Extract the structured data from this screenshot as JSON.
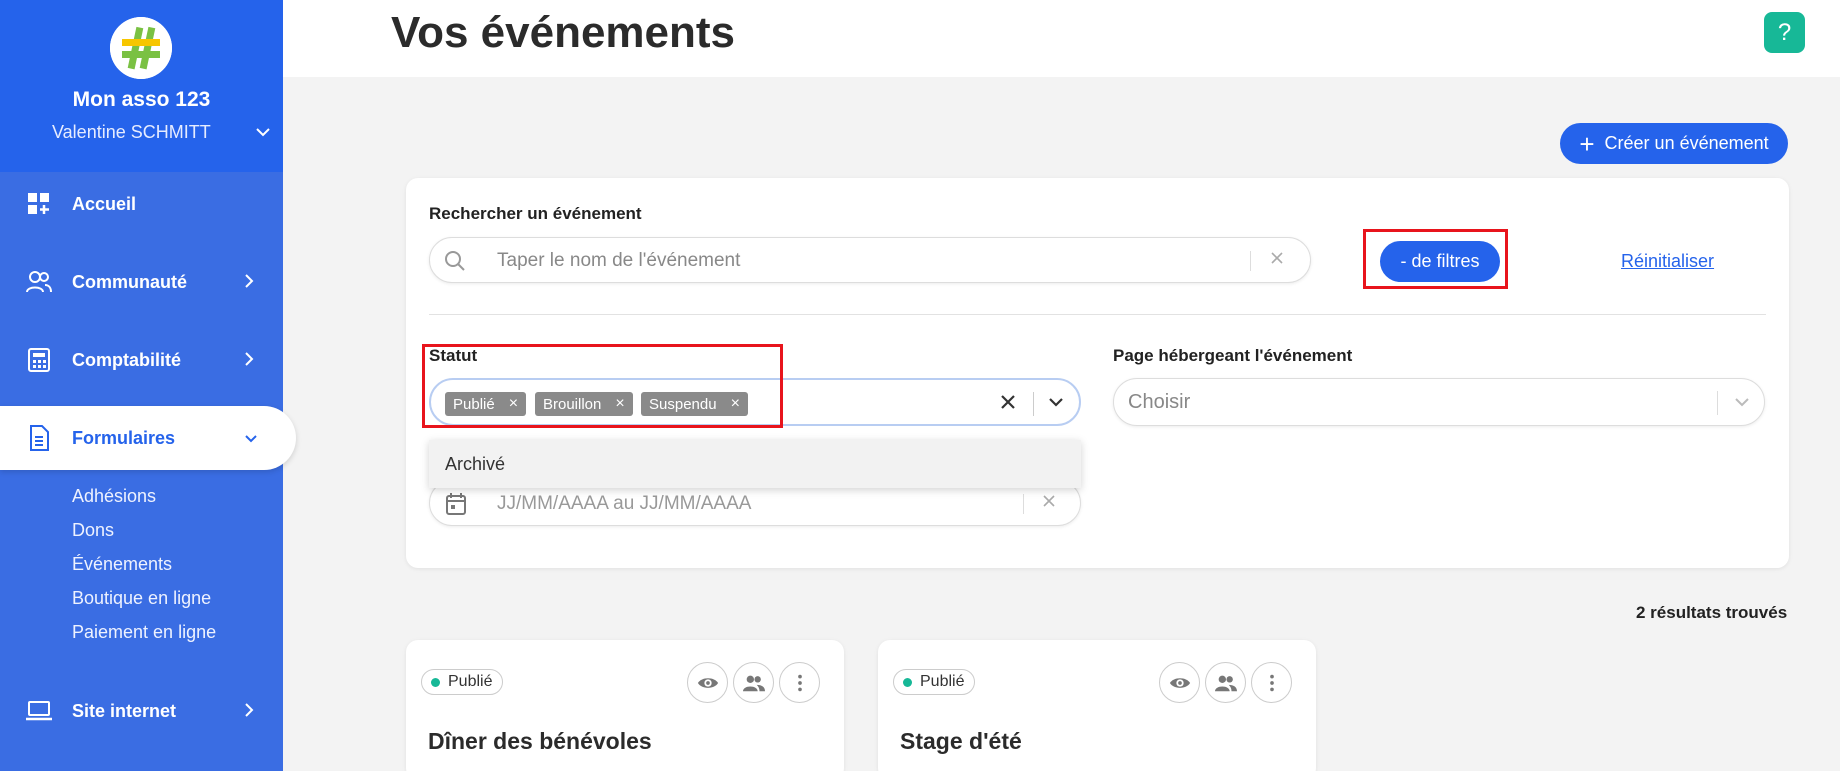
{
  "sidebar": {
    "org_name": "Mon asso 123",
    "user_name": "Valentine SCHMITT",
    "items": [
      {
        "label": "Accueil",
        "icon": "dashboard-icon"
      },
      {
        "label": "Communauté",
        "icon": "users-icon"
      },
      {
        "label": "Comptabilité",
        "icon": "calculator-icon"
      },
      {
        "label": "Formulaires",
        "icon": "document-icon",
        "active": true
      },
      {
        "label": "Site internet",
        "icon": "laptop-icon"
      }
    ],
    "subitems": [
      "Adhésions",
      "Dons",
      "Événements",
      "Boutique en ligne",
      "Paiement en ligne"
    ]
  },
  "header": {
    "title": "Vos événements",
    "help_label": "?"
  },
  "actions": {
    "create_label": "Créer un événement",
    "create_icon": "+"
  },
  "filters": {
    "search_label": "Rechercher un événement",
    "search_placeholder": "Taper le nom de l'événement",
    "less_filters_label": "- de filtres",
    "reset_label": "Réinitialiser",
    "status_label": "Statut",
    "status_tags": [
      "Publié",
      "Brouillon",
      "Suspendu"
    ],
    "status_options": [
      "Archivé"
    ],
    "page_label": "Page hébergeant l'événement",
    "page_placeholder": "Choisir",
    "date_placeholder": "JJ/MM/AAAA au JJ/MM/AAAA"
  },
  "results_text": "2 résultats trouvés",
  "events": [
    {
      "status": "Publié",
      "title": "Dîner des bénévoles"
    },
    {
      "status": "Publié",
      "title": "Stage d'été"
    }
  ],
  "colors": {
    "primary": "#2563eb",
    "sidebar": "#3a6de3",
    "help": "#17b897",
    "highlight": "#e8141c"
  }
}
